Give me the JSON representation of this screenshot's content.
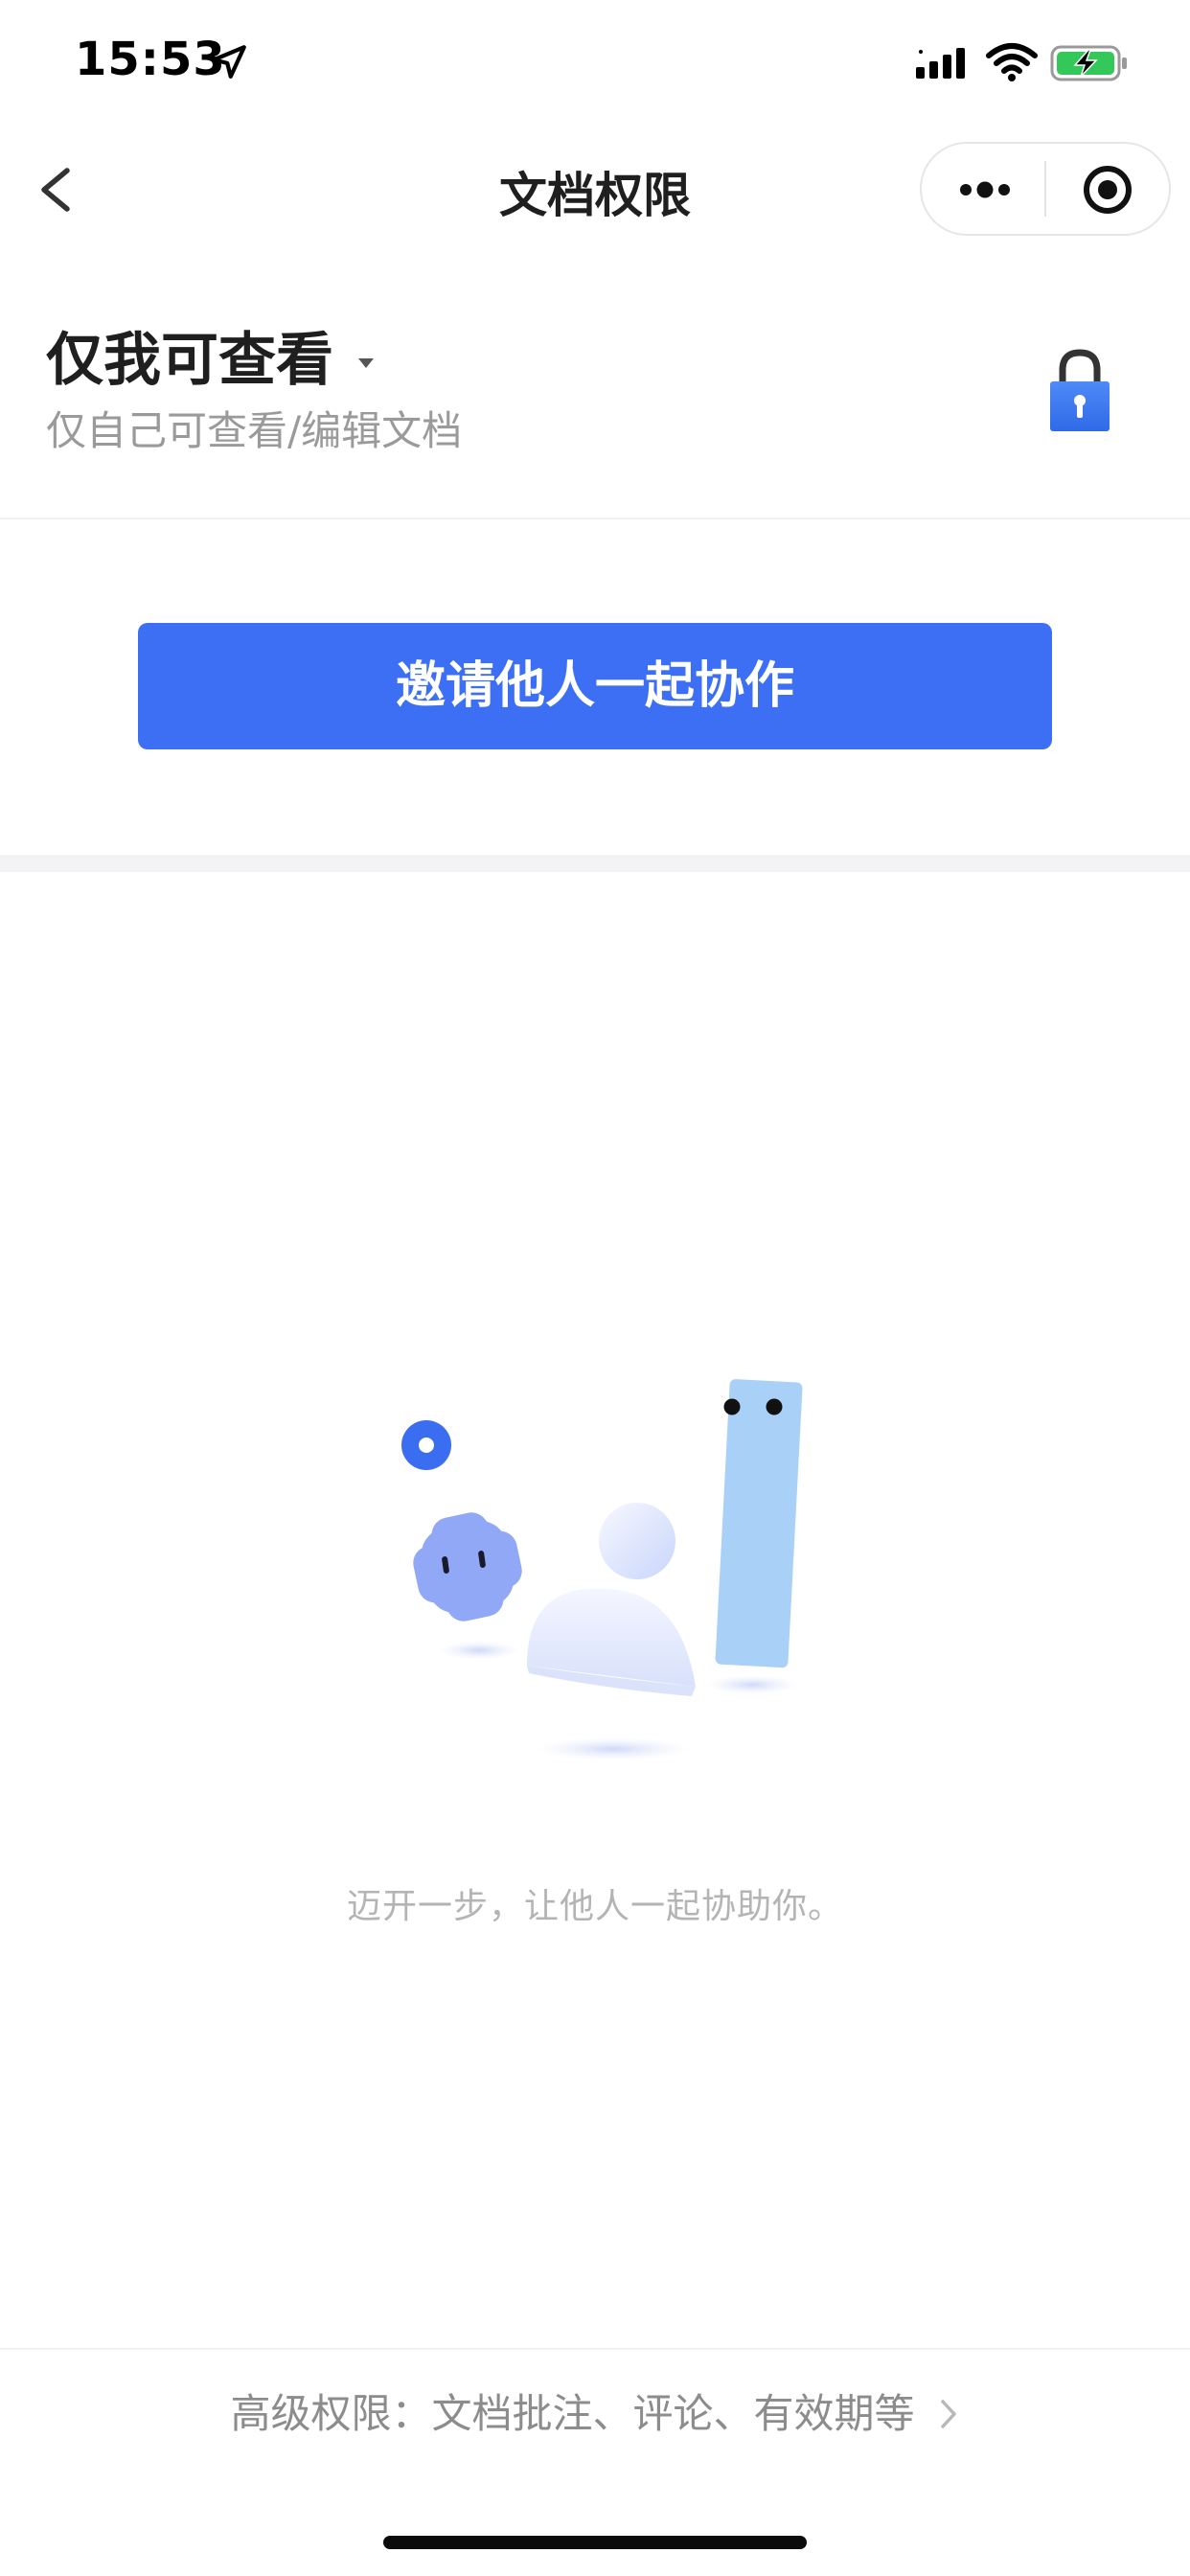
{
  "status_bar": {
    "time": "15:53"
  },
  "nav": {
    "title": "文档权限"
  },
  "permission": {
    "title": "仅我可查看",
    "description": "仅自己可查看/编辑文档"
  },
  "invite_button_label": "邀请他人一起协作",
  "empty_state": {
    "text": "迈开一步，让他人一起协助你。"
  },
  "advanced_link_text": "高级权限：文档批注、评论、有效期等",
  "colors": {
    "accent": "#3d6ff4",
    "battery_fill": "#34c759"
  },
  "icons": [
    "location-arrow-icon",
    "signal-icon",
    "wifi-icon",
    "battery-charging-icon",
    "back-chevron-icon",
    "more-dots-icon",
    "close-target-icon",
    "dropdown-triangle-icon",
    "lock-icon",
    "chevron-right-icon"
  ]
}
